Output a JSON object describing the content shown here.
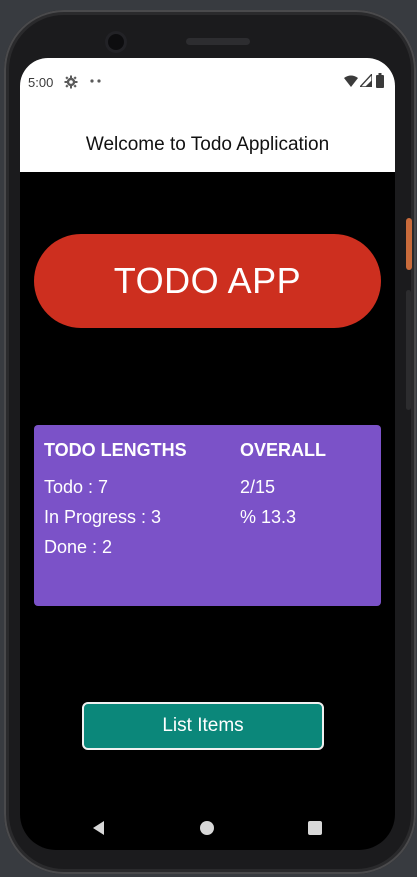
{
  "status_bar": {
    "time": "5:00",
    "icons": [
      "gear-icon",
      "dots-icon",
      "wifi-icon",
      "signal-icon",
      "battery-icon"
    ]
  },
  "app_bar": {
    "title": "Welcome to Todo Application"
  },
  "hero": {
    "label": "TODO APP",
    "color": "#cd2f1f"
  },
  "stats": {
    "color": "#7b52c8",
    "left_header": "TODO LENGTHS",
    "right_header": "OVERALL",
    "todo": "Todo : 7",
    "in_progress": "In Progress : 3",
    "done": "Done : 2",
    "overall_fraction": "2/15",
    "overall_percent": "% 13.3"
  },
  "list_button": {
    "label": "List Items",
    "color": "#0b877a"
  },
  "nav_bar": {
    "icons": [
      "back-icon",
      "home-icon",
      "recents-icon"
    ]
  }
}
